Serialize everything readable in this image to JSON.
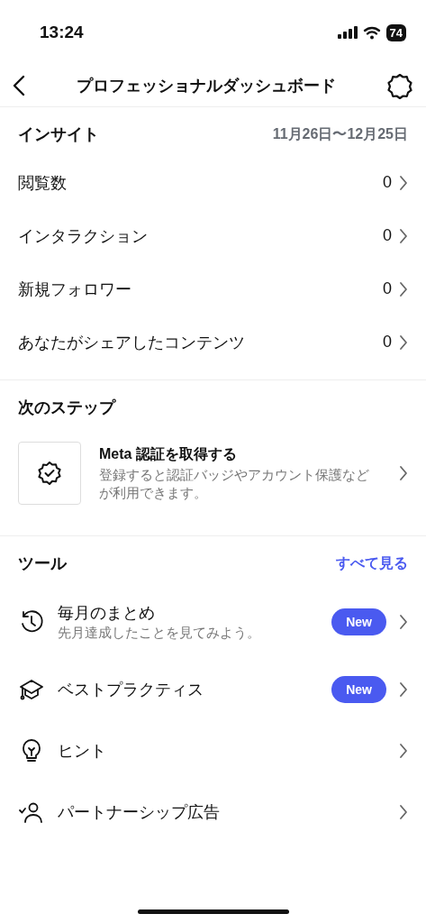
{
  "status_bar": {
    "time": "13:24",
    "battery": "74"
  },
  "header": {
    "title": "プロフェッショナルダッシュボード"
  },
  "insights": {
    "title": "インサイト",
    "date_range": "11月26日〜12月25日",
    "rows": [
      {
        "label": "閲覧数",
        "value": "0"
      },
      {
        "label": "インタラクション",
        "value": "0"
      },
      {
        "label": "新規フォロワー",
        "value": "0"
      },
      {
        "label": "あなたがシェアしたコンテンツ",
        "value": "0"
      }
    ]
  },
  "next_steps": {
    "title": "次のステップ",
    "items": [
      {
        "title": "Meta 認証を取得する",
        "description": "登録すると認証バッジやアカウント保護などが利用できます。"
      }
    ]
  },
  "tools": {
    "title": "ツール",
    "see_all": "すべて見る",
    "items": [
      {
        "kind": "history",
        "label": "毎月のまとめ",
        "subtitle": "先月達成したことを見てみよう。",
        "badge": "New"
      },
      {
        "kind": "graduation",
        "label": "ベストプラクティス",
        "badge": "New"
      },
      {
        "kind": "bulb",
        "label": "ヒント"
      },
      {
        "kind": "partner",
        "label": "パートナーシップ広告"
      }
    ]
  }
}
